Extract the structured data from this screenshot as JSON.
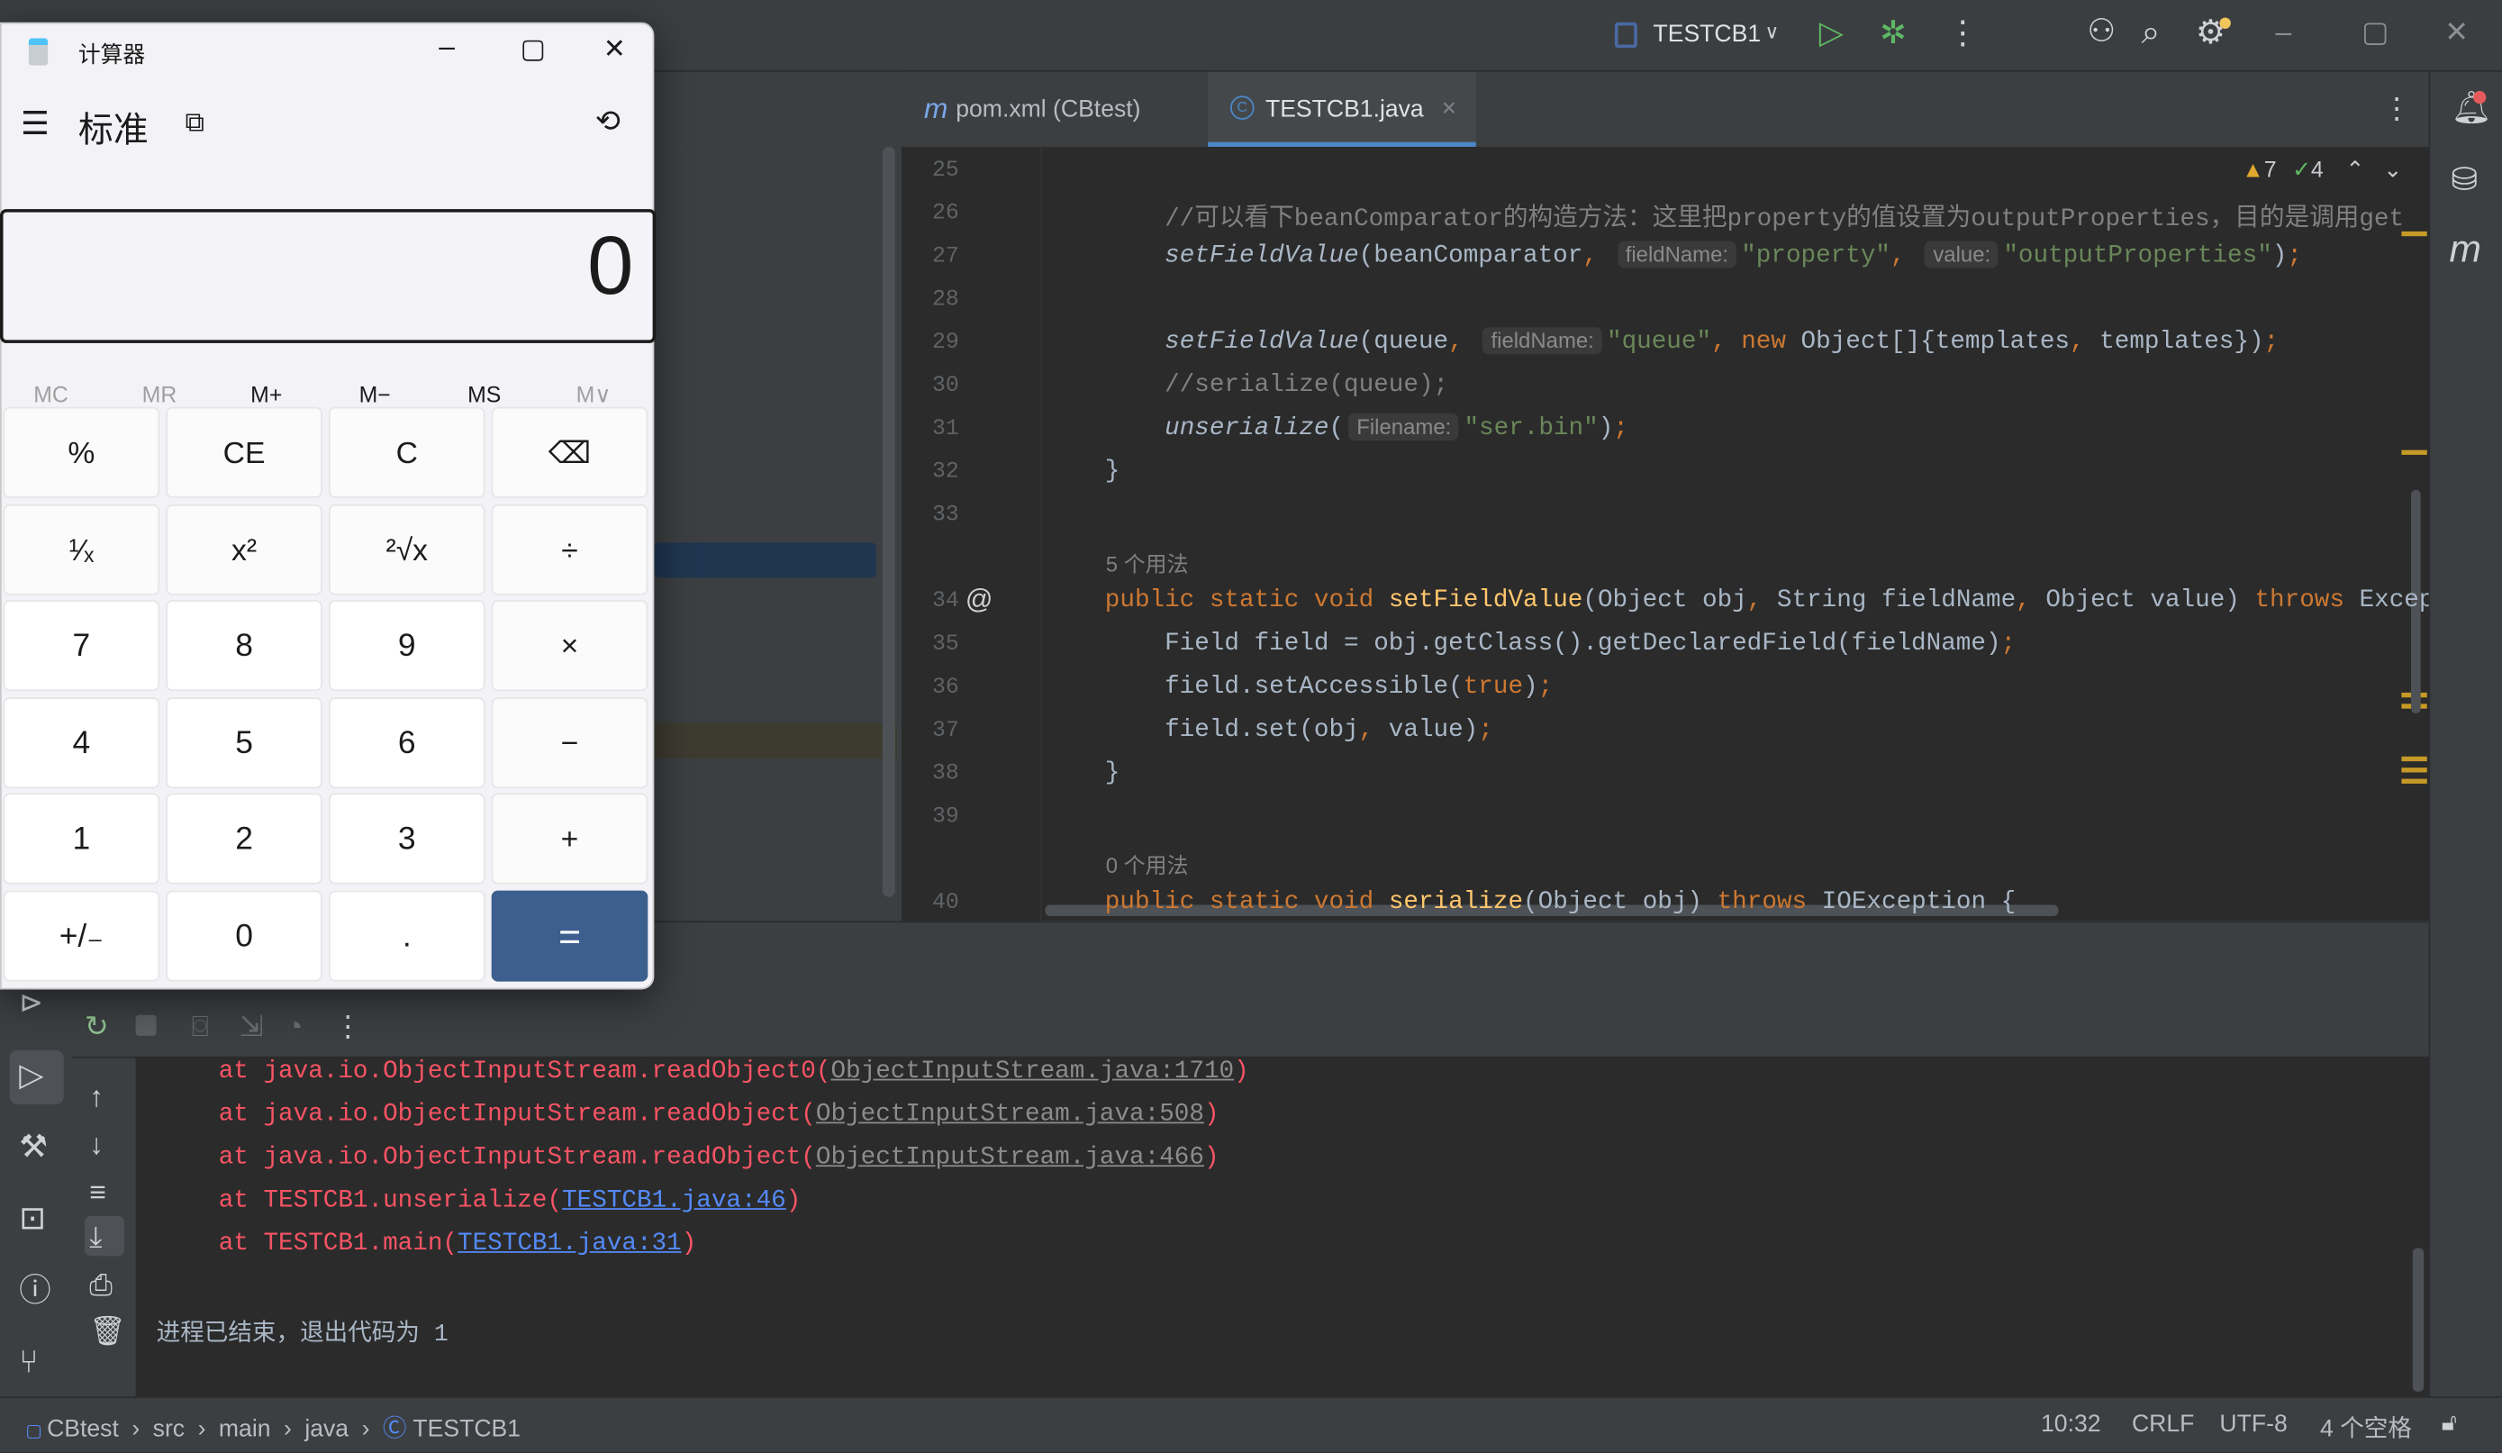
{
  "calculator": {
    "title": "计算器",
    "mode": "标准",
    "display": "0",
    "memory": [
      {
        "label": "MC",
        "enabled": false
      },
      {
        "label": "MR",
        "enabled": false
      },
      {
        "label": "M+",
        "enabled": true
      },
      {
        "label": "M−",
        "enabled": true
      },
      {
        "label": "MS",
        "enabled": true
      },
      {
        "label": "M∨",
        "enabled": false
      }
    ],
    "buttons": [
      [
        "%",
        "CE",
        "C",
        "⌫"
      ],
      [
        "¹⁄ₓ",
        "x²",
        "²√x",
        "÷"
      ],
      [
        "7",
        "8",
        "9",
        "×"
      ],
      [
        "4",
        "5",
        "6",
        "−"
      ],
      [
        "1",
        "2",
        "3",
        "+"
      ],
      [
        "+/₋",
        "0",
        ".",
        "="
      ]
    ],
    "equals_color": "#3d5f8e"
  },
  "toolbar": {
    "run_config": "TESTCB1",
    "icons": [
      "run-icon",
      "debug-icon",
      "more-icon",
      "add-user-icon",
      "search-icon",
      "gear-icon"
    ]
  },
  "tabs": [
    {
      "label": "pom.xml (CBtest)",
      "active": false
    },
    {
      "label": "TESTCB1.java",
      "active": true
    }
  ],
  "inspections": {
    "warnings": "7",
    "ok": "4"
  },
  "code": [
    {
      "n": "25",
      "t": []
    },
    {
      "n": "26",
      "t": [
        [
          "        //可以看下beanComparator的构造方法：这里把property的值设置为outputProperties，目的是调用get",
          "cm"
        ]
      ]
    },
    {
      "n": "27",
      "t": [
        [
          "        "
        ],
        [
          "setFieldValue",
          "it"
        ],
        [
          "(beanComparator"
        ],
        [
          ",",
          "pn"
        ],
        [
          " "
        ],
        [
          "fieldName:",
          "hint"
        ],
        [
          "\"property\"",
          "str"
        ],
        [
          ",",
          "pn"
        ],
        [
          " "
        ],
        [
          "value:",
          "hint"
        ],
        [
          "\"outputProperties\"",
          "str"
        ],
        [
          ")"
        ],
        [
          ";",
          "pn"
        ]
      ]
    },
    {
      "n": "28",
      "t": []
    },
    {
      "n": "29",
      "t": [
        [
          "        "
        ],
        [
          "setFieldValue",
          "it"
        ],
        [
          "(queue"
        ],
        [
          ",",
          "pn"
        ],
        [
          " "
        ],
        [
          "fieldName:",
          "hint"
        ],
        [
          "\"queue\"",
          "str"
        ],
        [
          ",",
          "pn"
        ],
        [
          " "
        ],
        [
          "new",
          "kw"
        ],
        [
          " Object[]{templates"
        ],
        [
          ",",
          "pn"
        ],
        [
          " templates})"
        ],
        [
          ";",
          "pn"
        ]
      ]
    },
    {
      "n": "30",
      "t": [
        [
          "        //serialize(queue);",
          "cm"
        ]
      ]
    },
    {
      "n": "31",
      "t": [
        [
          "        "
        ],
        [
          "unserialize",
          "it"
        ],
        [
          "("
        ],
        [
          "Filename:",
          "hint"
        ],
        [
          "\"ser.bin\"",
          "str"
        ],
        [
          ")"
        ],
        [
          ";",
          "pn"
        ]
      ]
    },
    {
      "n": "32",
      "t": [
        [
          "    }"
        ]
      ]
    },
    {
      "n": "33",
      "t": []
    },
    {
      "usage": "5 个用法"
    },
    {
      "n": "34",
      "at": true,
      "t": [
        [
          "    "
        ],
        [
          "public static void ",
          "kw"
        ],
        [
          "setFieldValue",
          "fn"
        ],
        [
          "(Object obj"
        ],
        [
          ",",
          "pn"
        ],
        [
          " String fieldName"
        ],
        [
          ",",
          "pn"
        ],
        [
          " Object value) "
        ],
        [
          "throws",
          "kw"
        ],
        [
          " Exception"
        ]
      ]
    },
    {
      "n": "35",
      "t": [
        [
          "        Field field = obj.getClass().getDeclaredField(fieldName)"
        ],
        [
          ";",
          "pn"
        ]
      ]
    },
    {
      "n": "36",
      "t": [
        [
          "        field.setAccessible("
        ],
        [
          "true",
          "kw"
        ],
        [
          ")"
        ],
        [
          ";",
          "pn"
        ]
      ]
    },
    {
      "n": "37",
      "t": [
        [
          "        field.set(obj"
        ],
        [
          ",",
          "pn"
        ],
        [
          " value)"
        ],
        [
          ";",
          "pn"
        ]
      ]
    },
    {
      "n": "38",
      "t": [
        [
          "    }"
        ]
      ]
    },
    {
      "n": "39",
      "t": []
    },
    {
      "usage": "0 个用法"
    },
    {
      "n": "40",
      "t": [
        [
          "    "
        ],
        [
          "public static void ",
          "kw"
        ],
        [
          "serialize",
          "fn"
        ],
        [
          "(Object obj) "
        ],
        [
          "throws",
          "kw"
        ],
        [
          " IOException {"
        ]
      ]
    }
  ],
  "console": {
    "lines": [
      {
        "pre": "at java.io.ObjectInputStream.readObject0(",
        "link": "ObjectInputStream.java:1710",
        "post": ")",
        "lib": true
      },
      {
        "pre": "at java.io.ObjectInputStream.readObject(",
        "link": "ObjectInputStream.java:508",
        "post": ")",
        "lib": true
      },
      {
        "pre": "at java.io.ObjectInputStream.readObject(",
        "link": "ObjectInputStream.java:466",
        "post": ")",
        "lib": true
      },
      {
        "pre": "at TESTCB1.unserialize(",
        "link": "TESTCB1.java:46",
        "post": ")",
        "lib": false
      },
      {
        "pre": "at TESTCB1.main(",
        "link": "TESTCB1.java:31",
        "post": ")",
        "lib": false
      }
    ],
    "exit": "进程已结束，退出代码为 1"
  },
  "breadcrumb": [
    "CBtest",
    "src",
    "main",
    "java",
    "TESTCB1"
  ],
  "status": {
    "position": "10:32",
    "line_sep": "CRLF",
    "encoding": "UTF-8",
    "indent": "4 个空格"
  }
}
